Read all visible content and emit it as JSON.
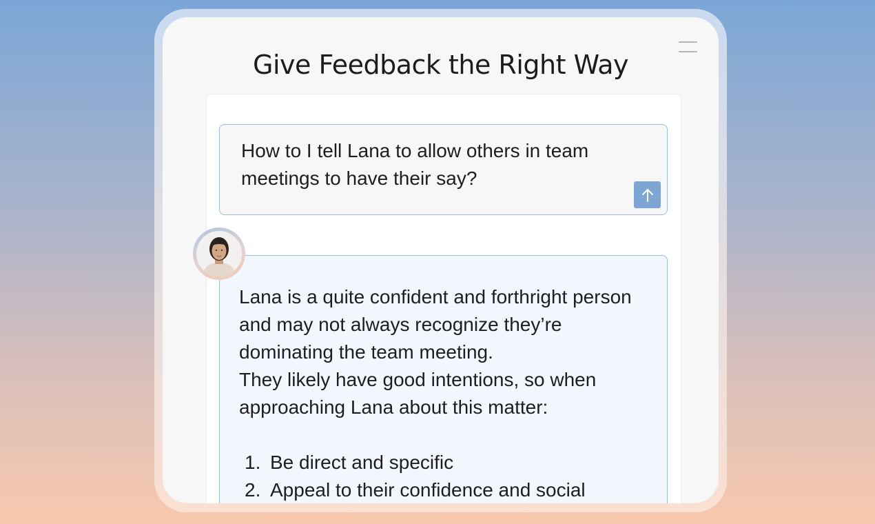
{
  "app": {
    "title": "Give Feedback the Right Way",
    "menu_icon": "hamburger-menu-icon"
  },
  "prompt": {
    "text": "How to I tell Lana to allow others in team meetings to have their say?",
    "send_icon": "arrow-up-icon"
  },
  "response": {
    "paragraph_1": "Lana is a quite confident and forthright person and may not always recognize they’re dominating the team meeting.",
    "paragraph_2": "They likely have good intentions, so when approaching Lana about this matter:",
    "steps": [
      {
        "number": "1.",
        "text": "Be direct and specific"
      },
      {
        "number": "2.",
        "text": "Appeal to their confidence and social"
      }
    ]
  },
  "colors": {
    "accent": "#7ea6d4",
    "border": "#9cbbd9",
    "response_bg": "#f1f7fd",
    "background_top": "#7ba6d6",
    "background_bottom": "#f8c8ae"
  }
}
